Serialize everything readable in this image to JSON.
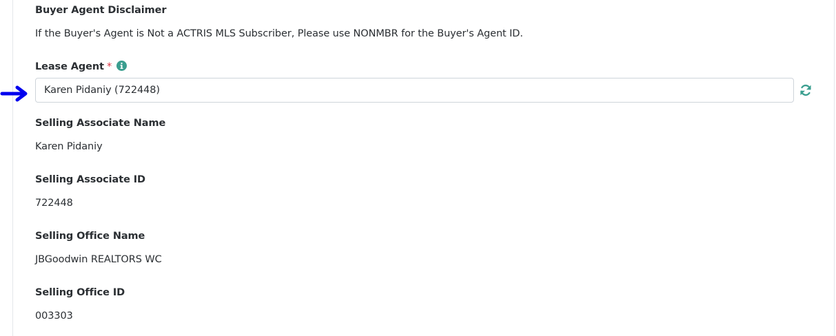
{
  "disclaimer": {
    "heading": "Buyer Agent Disclaimer",
    "text": "If the Buyer's Agent is Not a ACTRIS MLS Subscriber, Please use NONMBR for the Buyer's Agent ID."
  },
  "lease_agent": {
    "label": "Lease Agent",
    "required_mark": "*",
    "info_icon": "info-circle-icon",
    "value": "Karen Pidaniy (722448)",
    "refresh_icon": "refresh-icon",
    "pointer_icon": "arrow-right-icon"
  },
  "fields": {
    "selling_associate_name": {
      "label": "Selling Associate Name",
      "value": "Karen Pidaniy"
    },
    "selling_associate_id": {
      "label": "Selling Associate ID",
      "value": "722448"
    },
    "selling_office_name": {
      "label": "Selling Office Name",
      "value": "JBGoodwin REALTORS WC"
    },
    "selling_office_id": {
      "label": "Selling Office ID",
      "value": "003303"
    }
  },
  "colors": {
    "accent": "#3a9e8f",
    "required": "#dc3545",
    "pointer": "#0000ee"
  }
}
